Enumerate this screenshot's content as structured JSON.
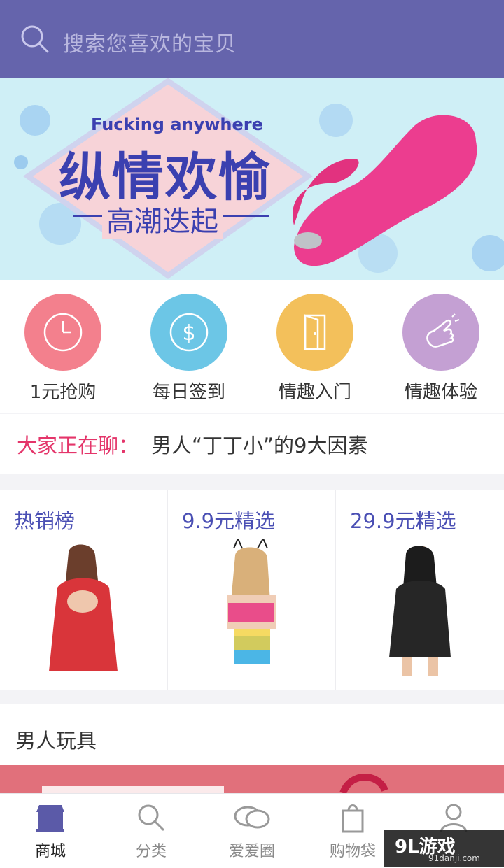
{
  "search": {
    "placeholder": "搜索您喜欢的宝贝"
  },
  "banner": {
    "eng_text": "Fucking anywhere",
    "headline": "纵情欢愉",
    "subline": "高潮迭起",
    "slide_count": 6,
    "active_slide": 3
  },
  "quick": [
    {
      "label": "1元抢购",
      "icon": "clock-icon",
      "color": "#f3808d"
    },
    {
      "label": "每日签到",
      "icon": "dollar-icon",
      "color": "#6cc6e6"
    },
    {
      "label": "情趣入门",
      "icon": "door-icon",
      "color": "#f3c05b"
    },
    {
      "label": "情趣体验",
      "icon": "finger-tap-icon",
      "color": "#c4a0d3"
    }
  ],
  "ticker": {
    "prefix": "大家正在聊：",
    "text": "男人“丁丁小”的9大因素"
  },
  "promo": [
    {
      "title": "热销榜"
    },
    {
      "title": "9.9元精选"
    },
    {
      "title": "29.9元精选"
    }
  ],
  "section": {
    "title": "男人玩具"
  },
  "tabbar": [
    {
      "label": "商城",
      "icon": "store-icon",
      "active": true
    },
    {
      "label": "分类",
      "icon": "search-icon",
      "active": false
    },
    {
      "label": "爱爱圈",
      "icon": "chat-bubbles-icon",
      "active": false
    },
    {
      "label": "购物袋",
      "icon": "shopping-bag-icon",
      "active": false
    },
    {
      "label": "",
      "icon": "user-icon",
      "active": false
    }
  ],
  "watermark": {
    "brand": "9L游戏",
    "site": "91danji.com"
  },
  "colors": {
    "header": "#6564ac",
    "accent": "#4a4fb4",
    "ticker_prefix": "#e4356a"
  }
}
